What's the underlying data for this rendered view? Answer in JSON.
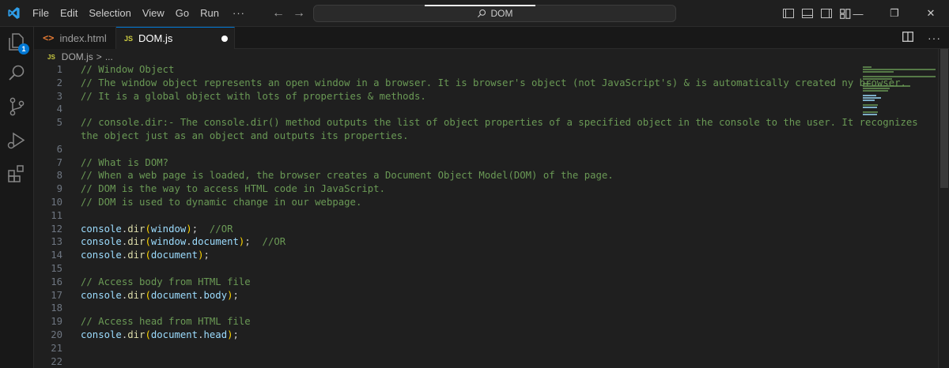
{
  "menu": [
    "File",
    "Edit",
    "Selection",
    "View",
    "Go",
    "Run",
    "···"
  ],
  "nav": {
    "back": "←",
    "forward": "→"
  },
  "search": {
    "text": "DOM"
  },
  "window_controls": {
    "minimize": "—",
    "restore": "❐",
    "close": "✕"
  },
  "activity": {
    "badge": "1"
  },
  "tabs": [
    {
      "label": "index.html",
      "glyph": "<>"
    },
    {
      "label": "DOM.js",
      "glyph": "JS"
    }
  ],
  "breadcrumb": {
    "glyph": "JS",
    "file": "DOM.js",
    "sep": ">",
    "rest": "..."
  },
  "editor": {
    "lines": [
      {
        "n": "1",
        "text": "// Window Object"
      },
      {
        "n": "2",
        "text": "// The window object represents an open window in a browser. It is browser's object (not JavaScript's) & is automatically created ny browser."
      },
      {
        "n": "3",
        "text": "// It is a global object with lots of properties & methods."
      },
      {
        "n": "4",
        "text": ""
      },
      {
        "n": "5",
        "text": "// console.dir:- The console.dir() method outputs the list of object properties of a specified object in the console to the user. It recognizes"
      },
      {
        "n": "",
        "text": "the object just as an object and outputs its properties."
      },
      {
        "n": "6",
        "text": ""
      },
      {
        "n": "7",
        "text": "// What is DOM?"
      },
      {
        "n": "8",
        "text": "// When a web page is loaded, the browser creates a Document Object Model(DOM) of the page."
      },
      {
        "n": "9",
        "text": "// DOM is the way to access HTML code in JavaScript."
      },
      {
        "n": "10",
        "text": "// DOM is used to dynamic change in our webpage."
      },
      {
        "n": "11",
        "text": ""
      },
      {
        "n": "12",
        "text": "console.dir(window);  //OR"
      },
      {
        "n": "13",
        "text": "console.dir(window.document);  //OR"
      },
      {
        "n": "14",
        "text": "console.dir(document);"
      },
      {
        "n": "15",
        "text": ""
      },
      {
        "n": "16",
        "text": "// Access body from HTML file"
      },
      {
        "n": "17",
        "text": "console.dir(document.body);"
      },
      {
        "n": "18",
        "text": ""
      },
      {
        "n": "19",
        "text": "// Access head from HTML file"
      },
      {
        "n": "20",
        "text": "console.dir(document.head);"
      },
      {
        "n": "21",
        "text": ""
      },
      {
        "n": "22",
        "text": ""
      }
    ]
  },
  "colors": {
    "comment": "#6a9955",
    "variable": "#9cdcfe",
    "function": "#dcdcaa",
    "bracket": "#ffd700",
    "accent": "#0078d4",
    "background": "#1f1f1f"
  },
  "icons": [
    "vscode-logo-icon",
    "explorer-icon",
    "search-icon",
    "source-control-icon",
    "run-debug-icon",
    "extensions-icon",
    "split-editor-icon",
    "more-actions-icon"
  ]
}
